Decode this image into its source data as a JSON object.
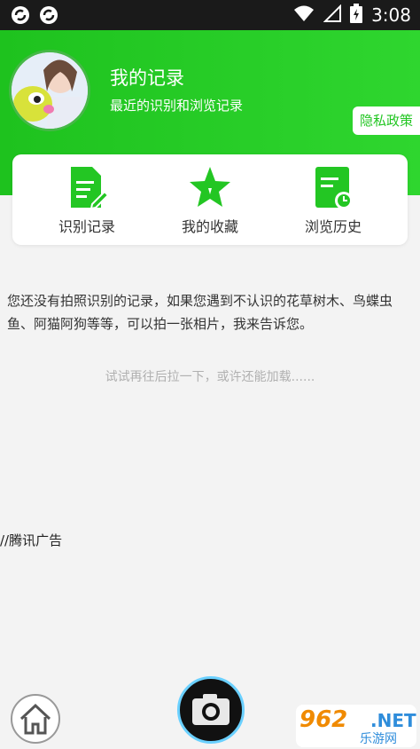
{
  "status_bar": {
    "time": "3:08"
  },
  "header": {
    "title": "我的记录",
    "subtitle": "最近的识别和浏览记录",
    "privacy_label": "隐私政策"
  },
  "card_items": [
    {
      "label": "识别记录",
      "icon": "document-edit-icon"
    },
    {
      "label": "我的收藏",
      "icon": "star-icon"
    },
    {
      "label": "浏览历史",
      "icon": "history-icon"
    }
  ],
  "main": {
    "empty_message": "您还没有拍照识别的记录，如果您遇到不认识的花草树木、鸟蝶虫鱼、阿猫阿狗等等，可以拍一张相片，我来告诉您。",
    "hint": "试试再往后拉一下，或许还能加载......",
    "ad_label": "//腾讯广告"
  },
  "watermark": {
    "text": "962",
    "net": ".NET",
    "sub": "乐游网"
  },
  "colors": {
    "brand_green": "#23c623",
    "hint_gray": "#b0b0b0"
  }
}
